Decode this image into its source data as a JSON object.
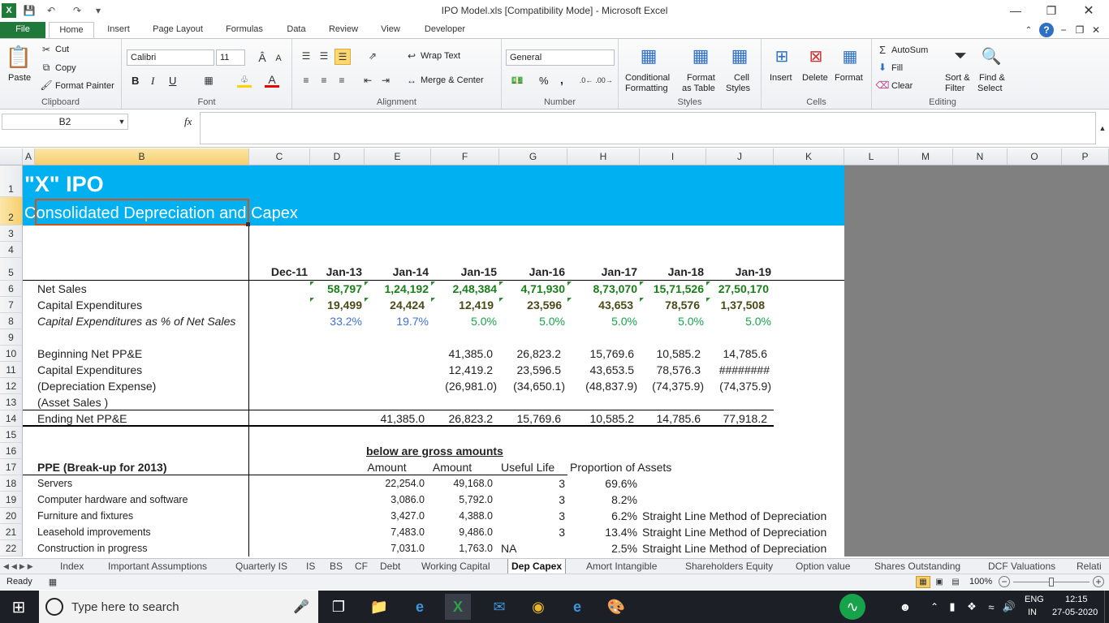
{
  "window": {
    "title": "IPO Model.xls  [Compatibility Mode]  -  Microsoft Excel"
  },
  "ribbon_tabs": [
    "File",
    "Home",
    "Insert",
    "Page Layout",
    "Formulas",
    "Data",
    "Review",
    "View",
    "Developer"
  ],
  "ribbon": {
    "clipboard": {
      "paste": "Paste",
      "cut": "Cut",
      "copy": "Copy",
      "format_painter": "Format Painter",
      "label": "Clipboard"
    },
    "font": {
      "name": "Calibri",
      "size": "11",
      "bold": "B",
      "italic": "I",
      "underline": "U",
      "label": "Font"
    },
    "alignment": {
      "wrap_text": "Wrap Text",
      "merge_center": "Merge & Center",
      "label": "Alignment"
    },
    "number": {
      "format": "General",
      "percent": "%",
      "comma": ",",
      "label": "Number"
    },
    "styles": {
      "conditional": "Conditional",
      "conditional2": "Formatting",
      "format_table": "Format",
      "format_table2": "as Table",
      "cell_styles": "Cell",
      "cell_styles2": "Styles",
      "label": "Styles"
    },
    "cells": {
      "insert": "Insert",
      "delete": "Delete",
      "format": "Format",
      "label": "Cells"
    },
    "editing": {
      "autosum": "AutoSum",
      "fill": "Fill",
      "clear": "Clear",
      "sort": "Sort &",
      "sort2": "Filter",
      "find": "Find &",
      "find2": "Select",
      "label": "Editing"
    }
  },
  "formula_bar": {
    "name_box": "B2",
    "fx": "fx",
    "content": ""
  },
  "columns": [
    "A",
    "B",
    "C",
    "D",
    "E",
    "F",
    "G",
    "H",
    "I",
    "J",
    "K",
    "L",
    "M",
    "N",
    "O",
    "P"
  ],
  "rows": [
    "1",
    "2",
    "3",
    "4",
    "5",
    "6",
    "7",
    "8",
    "9",
    "10",
    "11",
    "12",
    "13",
    "14",
    "15",
    "16",
    "17",
    "18",
    "19",
    "20",
    "21",
    "22"
  ],
  "sheet": {
    "title": "\"X\" IPO",
    "subtitle": "Consolidated Depreciation and Capex",
    "years": [
      "Dec-11",
      "Jan-13",
      "Jan-14",
      "Jan-15",
      "Jan-16",
      "Jan-17",
      "Jan-18",
      "Jan-19"
    ],
    "net_sales": {
      "label": "Net Sales",
      "values": [
        "58,797",
        "1,24,192",
        "2,48,384",
        "4,71,930",
        "8,73,070",
        "15,71,526",
        "27,50,170"
      ]
    },
    "capex": {
      "label": "Capital Expenditures",
      "values": [
        "19,499",
        "24,424",
        "12,419",
        "23,596",
        "43,653",
        "78,576",
        "1,37,508"
      ]
    },
    "capex_pct": {
      "label": "Capital Expenditures as % of Net Sales",
      "values": [
        "33.2%",
        "19.7%",
        "5.0%",
        "5.0%",
        "5.0%",
        "5.0%",
        "5.0%"
      ]
    },
    "beginning": {
      "label": "Beginning Net PP&E",
      "values": [
        "41,385.0",
        "26,823.2",
        "15,769.6",
        "10,585.2",
        "14,785.6"
      ]
    },
    "capex2": {
      "label": "Capital Expenditures",
      "values": [
        "12,419.2",
        "23,596.5",
        "43,653.5",
        "78,576.3",
        "########"
      ]
    },
    "depreciation": {
      "label": "(Depreciation Expense)",
      "values": [
        "(26,981.0)",
        "(34,650.1)",
        "(48,837.9)",
        "(74,375.9)",
        "(74,375.9)"
      ]
    },
    "asset_sales": {
      "label": "(Asset Sales )"
    },
    "ending": {
      "label": "Ending Net PP&E",
      "values": [
        "41,385.0",
        "26,823.2",
        "15,769.6",
        "10,585.2",
        "14,785.6",
        "77,918.2"
      ]
    },
    "gross_note": "below are gross amounts",
    "ppe_header": {
      "label": "PPE (Break-up for 2013)",
      "amount1": "Amount",
      "amount2": "Amount",
      "useful_life": "Useful Life",
      "proportion": "Proportion of Assets"
    },
    "ppe_rows": [
      {
        "label": "Servers",
        "a1": "22,254.0",
        "a2": "49,168.0",
        "life": "3",
        "prop": "69.6%",
        "note": ""
      },
      {
        "label": "Computer hardware and software",
        "a1": "3,086.0",
        "a2": "5,792.0",
        "life": "3",
        "prop": "8.2%",
        "note": ""
      },
      {
        "label": "Furniture and fixtures",
        "a1": "3,427.0",
        "a2": "4,388.0",
        "life": "3",
        "prop": "6.2%",
        "note": "Straight Line Method of Depreciation"
      },
      {
        "label": "Leasehold improvements",
        "a1": "7,483.0",
        "a2": "9,486.0",
        "life": "3",
        "prop": "13.4%",
        "note": "Straight Line Method of Depreciation"
      },
      {
        "label": "Construction in progress",
        "a1": "7,031.0",
        "a2": "1,763.0",
        "life": "NA",
        "prop": "2.5%",
        "note": "Straight Line Method of Depreciation"
      }
    ]
  },
  "sheet_tabs": [
    "Index",
    "Important Assumptions",
    "Quarterly IS",
    "IS",
    "BS",
    "CF",
    "Debt",
    "Working Capital",
    "Dep Capex",
    "Amort Intangible",
    "Shareholders Equity",
    "Option value",
    "Shares Outstanding",
    "DCF Valuations",
    "Relati"
  ],
  "status": {
    "ready": "Ready",
    "zoom": "100%"
  },
  "taskbar": {
    "search": "Type here to search",
    "lang1": "ENG",
    "lang2": "IN",
    "time": "12:15",
    "date": "27-05-2020"
  },
  "colors": {
    "header_blue": "#00b0f0",
    "gray_area": "#808080",
    "excel_green": "#1f7a3a"
  }
}
